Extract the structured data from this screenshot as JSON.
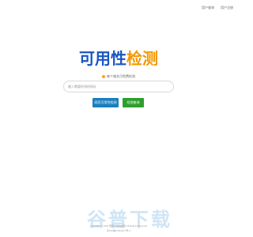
{
  "header": {
    "links": [
      "用户查询",
      "用户注册"
    ]
  },
  "logo": {
    "part_blue": "可用性",
    "part_orange": "检测",
    "colors": {
      "blue": "#1a56c4",
      "orange": "#f39800"
    }
  },
  "notice": {
    "icon": "info-icon",
    "text": "每个域名可免费检测"
  },
  "search": {
    "placeholder": "输入需要检测的网址"
  },
  "buttons": {
    "check": "网页可用性检测",
    "history": "检测查询"
  },
  "footer": {
    "line1": "Copyright © 2024 网页可用性检测 All Rights Reserved",
    "line2": "京ICP备17013217号-2"
  },
  "watermark": {
    "text": "谷普下载"
  }
}
